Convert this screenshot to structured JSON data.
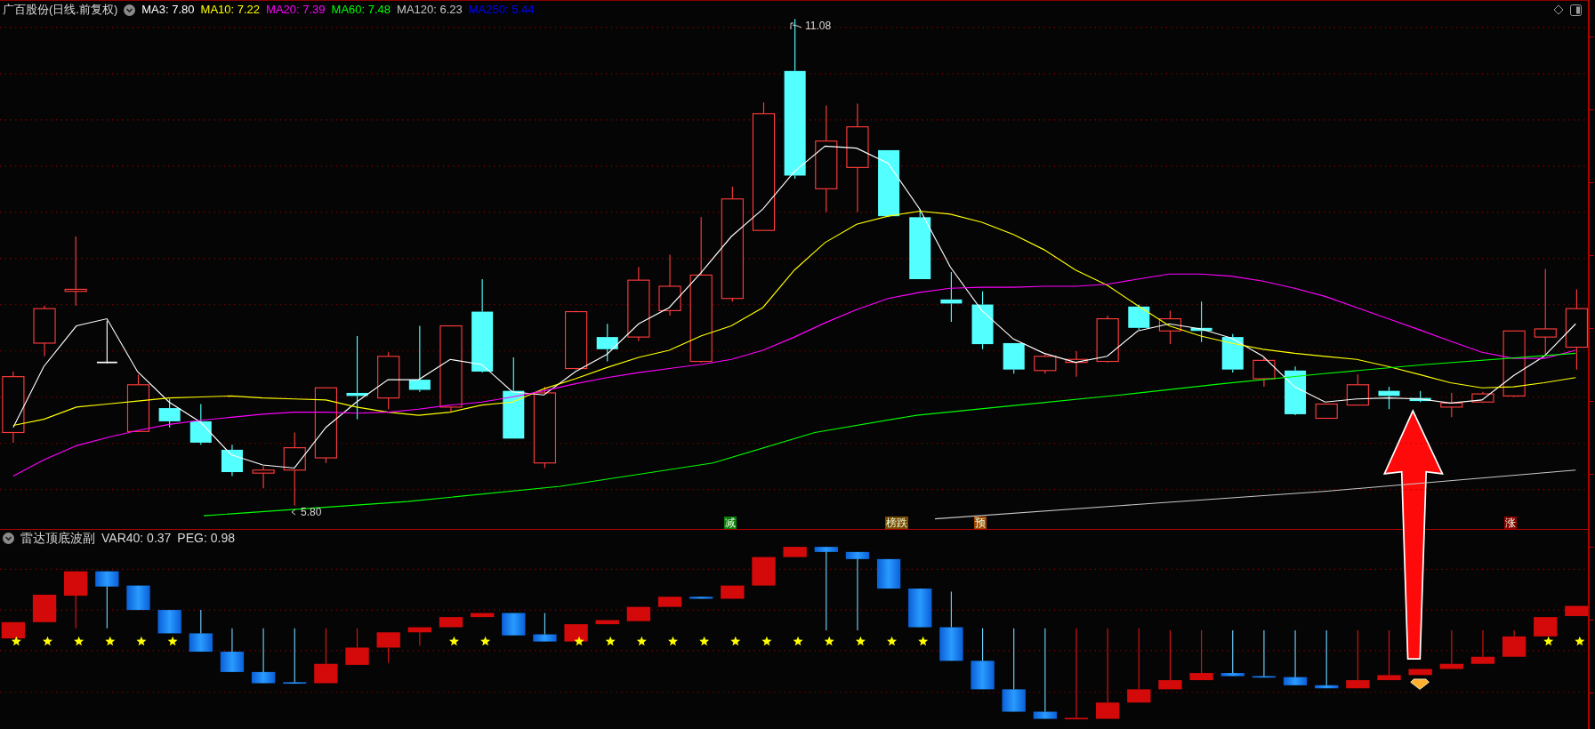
{
  "price_panel": {
    "title": "广百股份(日线.前复权)",
    "ma_legend": [
      {
        "text": "MA3: 7.80",
        "color": "#ffffff"
      },
      {
        "text": "MA10: 7.22",
        "color": "#ffff00"
      },
      {
        "text": "MA20: 7.39",
        "color": "#ff00ff"
      },
      {
        "text": "MA60: 7.48",
        "color": "#00ff00"
      },
      {
        "text": "MA120: 6.23",
        "color": "#c8c8c8"
      },
      {
        "text": "MA250: 5.44",
        "color": "#0000ff"
      }
    ],
    "high_label": "11.08",
    "low_label": "5.80",
    "signals": [
      {
        "text": "减",
        "color": "#0a7d0a"
      },
      {
        "text": "榜跌",
        "color": "#7a4a00"
      },
      {
        "text": "预",
        "color": "#a04800"
      },
      {
        "text": "涨",
        "color": "#8a0000"
      }
    ]
  },
  "indicator_panel": {
    "title": "雷达顶底波副",
    "values": [
      "VAR40: 0.37",
      "PEG: 0.98"
    ]
  }
}
